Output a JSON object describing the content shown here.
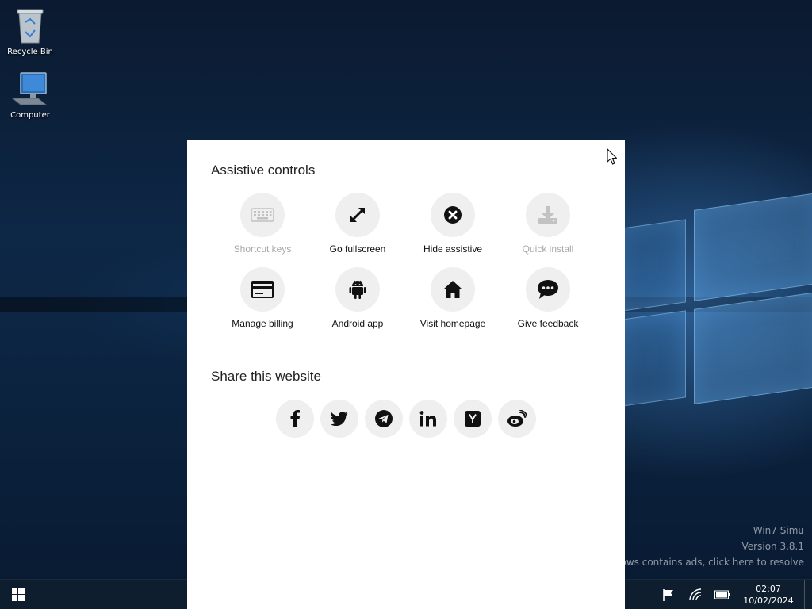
{
  "desktop": {
    "icons": [
      {
        "label": "Recycle Bin",
        "icon": "recycle-bin-icon"
      },
      {
        "label": "Computer",
        "icon": "computer-icon"
      }
    ],
    "watermark": {
      "line1": "Win7 Simu",
      "line2": "Version 3.8.1",
      "line3": "ows contains ads, click here to resolve"
    }
  },
  "panel": {
    "controls_title": "Assistive controls",
    "controls": [
      {
        "label": "Shortcut keys",
        "icon": "keyboard-icon",
        "enabled": false
      },
      {
        "label": "Go fullscreen",
        "icon": "expand-icon",
        "enabled": true
      },
      {
        "label": "Hide assistive",
        "icon": "close-circle-icon",
        "enabled": true
      },
      {
        "label": "Quick install",
        "icon": "download-icon",
        "enabled": false
      },
      {
        "label": "Manage billing",
        "icon": "credit-card-icon",
        "enabled": true
      },
      {
        "label": "Android app",
        "icon": "android-icon",
        "enabled": true
      },
      {
        "label": "Visit homepage",
        "icon": "home-icon",
        "enabled": true
      },
      {
        "label": "Give feedback",
        "icon": "chat-bubble-icon",
        "enabled": true
      }
    ],
    "share_title": "Share this website",
    "share": [
      {
        "name": "facebook",
        "icon": "facebook-icon",
        "glyph": "f"
      },
      {
        "name": "twitter",
        "icon": "twitter-icon"
      },
      {
        "name": "telegram",
        "icon": "telegram-icon"
      },
      {
        "name": "linkedin",
        "icon": "linkedin-icon",
        "glyph": "in"
      },
      {
        "name": "hacker-news",
        "icon": "hacker-news-icon",
        "glyph": "Y"
      },
      {
        "name": "weibo",
        "icon": "weibo-icon"
      }
    ]
  },
  "taskbar": {
    "clock": {
      "time": "02:07",
      "date": "10/02/2024"
    },
    "tray": [
      "flag-icon",
      "network-icon",
      "battery-icon"
    ]
  },
  "colors": {
    "panel_bg": "#ffffff",
    "circle_bg": "#efefef",
    "disabled_text": "#a8a8a8",
    "taskbar_bg": "#0e1e2e"
  }
}
